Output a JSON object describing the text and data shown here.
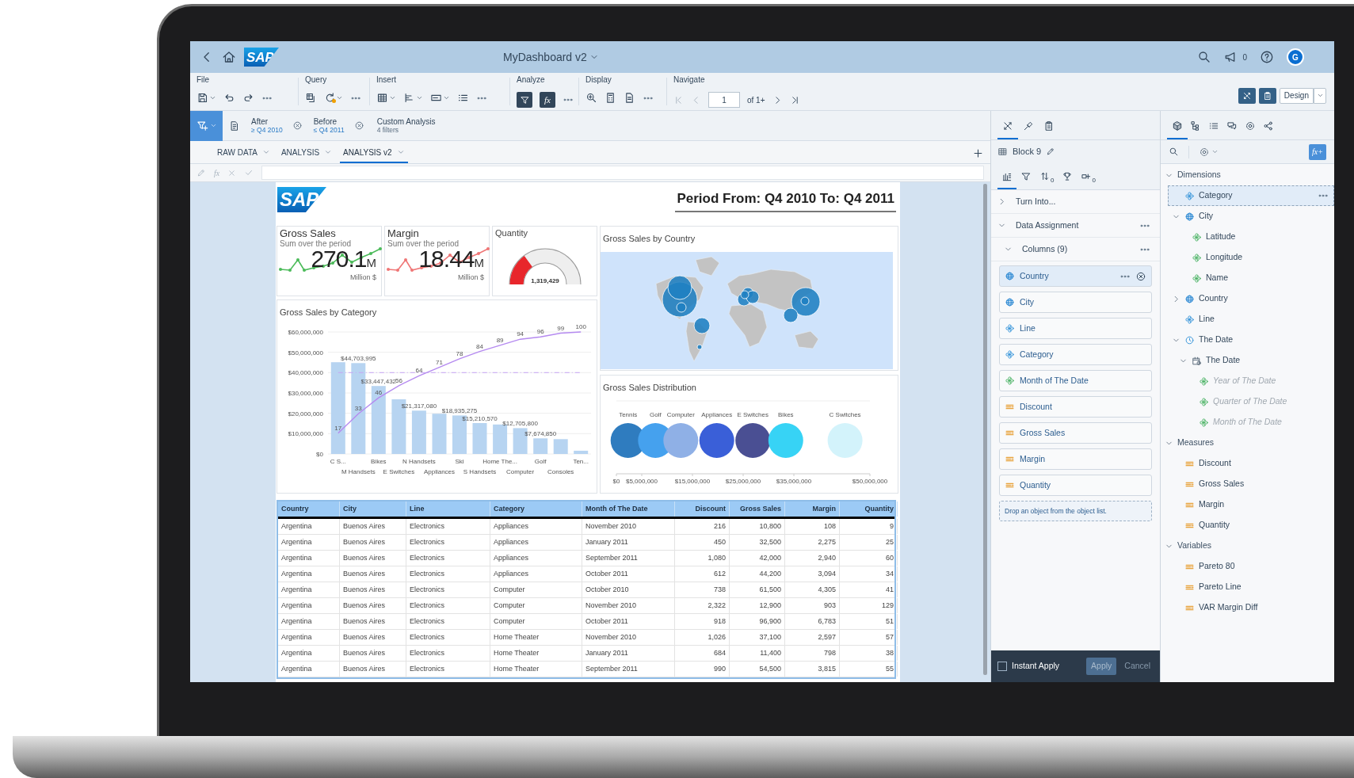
{
  "shell": {
    "logo": "SAP",
    "title": "MyDashboard v2",
    "notifications": "0",
    "avatar": "G"
  },
  "toolbar": {
    "groups": [
      {
        "label": "File"
      },
      {
        "label": "Query"
      },
      {
        "label": "Insert"
      },
      {
        "label": "Analyze"
      },
      {
        "label": "Display"
      },
      {
        "label": "Navigate"
      }
    ],
    "filter_pressed": true,
    "formula": {
      "label": "fx",
      "pressed": true
    },
    "page": "1",
    "page_of": "of 1+",
    "mode": "Design"
  },
  "filters": [
    {
      "label": "After",
      "value": "≥ Q4 2010"
    },
    {
      "label": "Before",
      "value": "≤ Q4 2011"
    }
  ],
  "custom_analysis": {
    "label": "Custom Analysis",
    "count": "4 filters"
  },
  "report_tabs": [
    {
      "label": "RAW DATA",
      "selected": false
    },
    {
      "label": "ANALYSIS",
      "selected": false
    },
    {
      "label": "ANALYSIS v2",
      "selected": true
    }
  ],
  "formula_bar": {
    "symbol": "fx"
  },
  "report": {
    "logo": "SAP",
    "title": "Period From: Q4 2010 To: Q4 2011",
    "kpis": [
      {
        "kind": "sparkline",
        "title": "Gross Sales",
        "subtitle": "Sum over the period",
        "value": "270.1",
        "unit": "M",
        "caption": "Million $",
        "color": "#4cbb5a"
      },
      {
        "kind": "sparkline",
        "title": "Margin",
        "subtitle": "Sum over the period",
        "value": "18.44",
        "unit": "M",
        "caption": "Million $",
        "color": "#ef7676"
      },
      {
        "kind": "gauge",
        "title": "Quantity",
        "value": "1,319,429",
        "level": 0.3
      }
    ],
    "category_chart": {
      "chart_data": {
        "type": "bar",
        "title": "Gross Sales by Category",
        "categories": [
          "C S...",
          "M Handsets",
          "Bikes",
          "E Switches",
          "N Handsets",
          "Appliances",
          "Ski",
          "S Handsets",
          "Home The...",
          "Computer",
          "Golf",
          "Consoles",
          "Ten..."
        ],
        "series": [
          {
            "color": "#b7d4f1",
            "values": [
              45100000,
              44703995,
              33447432,
              26900000,
              21317080,
              19800000,
              18935275,
              15210570,
              14500000,
              12705800,
              7674850,
              7300000,
              1600000
            ]
          }
        ],
        "value_labels": [
          null,
          "$44,703,995",
          "$33,447,432",
          null,
          "$21,317,080",
          null,
          "$18,935,275",
          "$15,210,570",
          null,
          "$12,705,800",
          "$7,674,850",
          null,
          null
        ],
        "ylim": [
          0,
          60000000
        ],
        "yticks": [
          {
            "value": 0,
            "label": "$0"
          },
          {
            "value": 10000000,
            "label": "$10,000,000"
          },
          {
            "value": 20000000,
            "label": "$20,000,000"
          },
          {
            "value": 30000000,
            "label": "$30,000,000"
          },
          {
            "value": 40000000,
            "label": "$40,000,000"
          },
          {
            "value": 50000000,
            "label": "$50,000,000"
          },
          {
            "value": 60000000,
            "label": "$60,000,000"
          }
        ],
        "grid": true
      },
      "pareto": {
        "chart_data": {
          "type": "line",
          "data_labels": true,
          "categories": [
            null,
            null,
            null,
            null,
            null,
            null,
            null,
            null,
            null,
            null,
            null,
            null,
            null
          ],
          "series": [
            {
              "color": "#b58af0",
              "values": [
                17,
                33,
                46,
                56,
                64,
                71,
                78,
                84,
                89,
                94,
                96,
                99,
                100
              ]
            }
          ]
        }
      }
    },
    "map": {
      "title": "Gross Sales by Country"
    },
    "distribution": {
      "chart_data": {
        "type": "scatter",
        "title": "Gross Sales Distribution",
        "orientation": "horizontal",
        "categories": [
          null
        ],
        "series": [
          {
            "name": "Tennis",
            "color": "#2f7cbf",
            "values": [
              2300000
            ]
          },
          {
            "name": "Golf",
            "color": "#45a1ee",
            "values": [
              7700000
            ]
          },
          {
            "name": "Computer",
            "color": "#8fb0e6",
            "values": [
              12700000
            ]
          },
          {
            "name": "Appliances",
            "color": "#3a5fd8",
            "values": [
              19800000
            ]
          },
          {
            "name": "E Switches",
            "color": "#4a4f93",
            "values": [
              26900000
            ]
          },
          {
            "name": "Bikes",
            "color": "#37d3f5",
            "values": [
              33400000
            ]
          },
          {
            "name": "C Switches",
            "color": "#d3f3fb",
            "values": [
              45100000
            ]
          }
        ],
        "xlim": [
          0,
          50000000
        ],
        "xticks": [
          {
            "value": 0,
            "label": "$0"
          },
          {
            "value": 5000000,
            "label": "$5,000,000"
          },
          {
            "value": 15000000,
            "label": "$15,000,000"
          },
          {
            "value": 25000000,
            "label": "$25,000,000"
          },
          {
            "value": 35000000,
            "label": "$35,000,000"
          },
          {
            "value": 50000000,
            "label": "$50,000,000"
          }
        ]
      }
    },
    "table": {
      "columns": [
        {
          "label": "Country",
          "kind": "dimension"
        },
        {
          "label": "City",
          "kind": "dimension"
        },
        {
          "label": "Line",
          "kind": "dimension"
        },
        {
          "label": "Category",
          "kind": "dimension"
        },
        {
          "label": "Month of The Date",
          "kind": "dimension"
        },
        {
          "label": "Discount",
          "kind": "measure"
        },
        {
          "label": "Gross Sales",
          "kind": "measure"
        },
        {
          "label": "Margin",
          "kind": "measure"
        },
        {
          "label": "Quantity",
          "kind": "measure"
        }
      ],
      "rows": [
        [
          "Argentina",
          "Buenos Aires",
          "Electronics",
          "Appliances",
          "November 2010",
          "216",
          "10,800",
          "108",
          "9"
        ],
        [
          "Argentina",
          "Buenos Aires",
          "Electronics",
          "Appliances",
          "January 2011",
          "450",
          "32,500",
          "2,275",
          "25"
        ],
        [
          "Argentina",
          "Buenos Aires",
          "Electronics",
          "Appliances",
          "September 2011",
          "1,080",
          "42,000",
          "2,940",
          "60"
        ],
        [
          "Argentina",
          "Buenos Aires",
          "Electronics",
          "Appliances",
          "October 2011",
          "612",
          "44,200",
          "3,094",
          "34"
        ],
        [
          "Argentina",
          "Buenos Aires",
          "Electronics",
          "Computer",
          "October 2010",
          "738",
          "61,500",
          "4,305",
          "41"
        ],
        [
          "Argentina",
          "Buenos Aires",
          "Electronics",
          "Computer",
          "November 2010",
          "2,322",
          "12,900",
          "903",
          "129"
        ],
        [
          "Argentina",
          "Buenos Aires",
          "Electronics",
          "Computer",
          "October 2011",
          "918",
          "96,900",
          "6,783",
          "51"
        ],
        [
          "Argentina",
          "Buenos Aires",
          "Electronics",
          "Home Theater",
          "November 2010",
          "1,026",
          "37,100",
          "2,597",
          "57"
        ],
        [
          "Argentina",
          "Buenos Aires",
          "Electronics",
          "Home Theater",
          "January 2011",
          "684",
          "11,400",
          "798",
          "38"
        ],
        [
          "Argentina",
          "Buenos Aires",
          "Electronics",
          "Home Theater",
          "September 2011",
          "990",
          "54,500",
          "3,815",
          "55"
        ]
      ]
    }
  },
  "builder": {
    "tool_tabs": [
      {
        "selected": true
      },
      {
        "selected": false
      },
      {
        "selected": false
      }
    ],
    "block": "Block 9",
    "data_tabs": [
      {
        "selected": true
      },
      {
        "selected": false
      },
      {
        "selected": false,
        "count": "0"
      },
      {
        "selected": false
      },
      {
        "selected": false,
        "count": "0"
      }
    ],
    "turn_into": {
      "label": "Turn Into...",
      "expanded": false
    },
    "data_assignment": {
      "label": "Data Assignment",
      "expanded": true
    },
    "columns_group": {
      "label": "Columns (9)",
      "expanded": true
    },
    "columns": [
      {
        "label": "Country",
        "kind": "geo",
        "selected": true
      },
      {
        "label": "City",
        "kind": "geo",
        "selected": false
      },
      {
        "label": "Line",
        "kind": "dimension",
        "selected": false
      },
      {
        "label": "Category",
        "kind": "dimension",
        "selected": false
      },
      {
        "label": "Month of The Date",
        "kind": "detail",
        "selected": false
      },
      {
        "label": "Discount",
        "kind": "measure",
        "selected": false
      },
      {
        "label": "Gross Sales",
        "kind": "measure",
        "selected": false
      },
      {
        "label": "Margin",
        "kind": "measure",
        "selected": false
      },
      {
        "label": "Quantity",
        "kind": "measure",
        "selected": false
      }
    ],
    "drop_hint": "Drop an object from the object list.",
    "instant_apply": {
      "label": "Instant Apply",
      "checked": false
    },
    "apply": "Apply",
    "cancel": "Cancel"
  },
  "objects": {
    "tabs": [
      {
        "selected": true
      },
      {
        "selected": false
      },
      {
        "selected": false
      },
      {
        "selected": false
      },
      {
        "selected": false
      },
      {
        "selected": false
      }
    ],
    "formula_button": "fx+",
    "tree": [
      {
        "label": "Dimensions",
        "kind": "folder",
        "expanded": true,
        "selected": false,
        "disabled": false,
        "children": [
          {
            "label": "Category",
            "kind": "dimension",
            "selected": true,
            "disabled": false
          },
          {
            "label": "City",
            "kind": "geo",
            "expanded": true,
            "selected": false,
            "disabled": false,
            "children": [
              {
                "label": "Latitude",
                "kind": "detail",
                "selected": false,
                "disabled": false
              },
              {
                "label": "Longitude",
                "kind": "detail",
                "selected": false,
                "disabled": false
              },
              {
                "label": "Name",
                "kind": "detail",
                "selected": false,
                "disabled": false
              }
            ]
          },
          {
            "label": "Country",
            "kind": "geo",
            "expanded": false,
            "selected": false,
            "disabled": false
          },
          {
            "label": "Line",
            "kind": "dimension",
            "selected": false,
            "disabled": false
          },
          {
            "label": "The Date",
            "kind": "time",
            "expanded": true,
            "selected": false,
            "disabled": false,
            "children": [
              {
                "label": "The Date",
                "kind": "calendar",
                "expanded": true,
                "selected": false,
                "disabled": false,
                "children": [
                  {
                    "label": "Year of The Date",
                    "kind": "detail",
                    "selected": false,
                    "disabled": true
                  },
                  {
                    "label": "Quarter of The Date",
                    "kind": "detail",
                    "selected": false,
                    "disabled": true
                  },
                  {
                    "label": "Month of The Date",
                    "kind": "detail",
                    "selected": false,
                    "disabled": true
                  }
                ]
              }
            ]
          }
        ]
      },
      {
        "label": "Measures",
        "kind": "folder",
        "expanded": true,
        "selected": false,
        "disabled": false,
        "children": [
          {
            "label": "Discount",
            "kind": "measure",
            "selected": false,
            "disabled": false
          },
          {
            "label": "Gross Sales",
            "kind": "measure",
            "selected": false,
            "disabled": false
          },
          {
            "label": "Margin",
            "kind": "measure",
            "selected": false,
            "disabled": false
          },
          {
            "label": "Quantity",
            "kind": "measure",
            "selected": false,
            "disabled": false
          }
        ]
      },
      {
        "label": "Variables",
        "kind": "folder",
        "expanded": true,
        "selected": false,
        "disabled": false,
        "children": [
          {
            "label": "Pareto 80",
            "kind": "measure",
            "selected": false,
            "disabled": false
          },
          {
            "label": "Pareto Line",
            "kind": "measure",
            "selected": false,
            "disabled": false
          },
          {
            "label": "VAR Margin Diff",
            "kind": "measure",
            "selected": false,
            "disabled": false
          }
        ]
      }
    ]
  }
}
